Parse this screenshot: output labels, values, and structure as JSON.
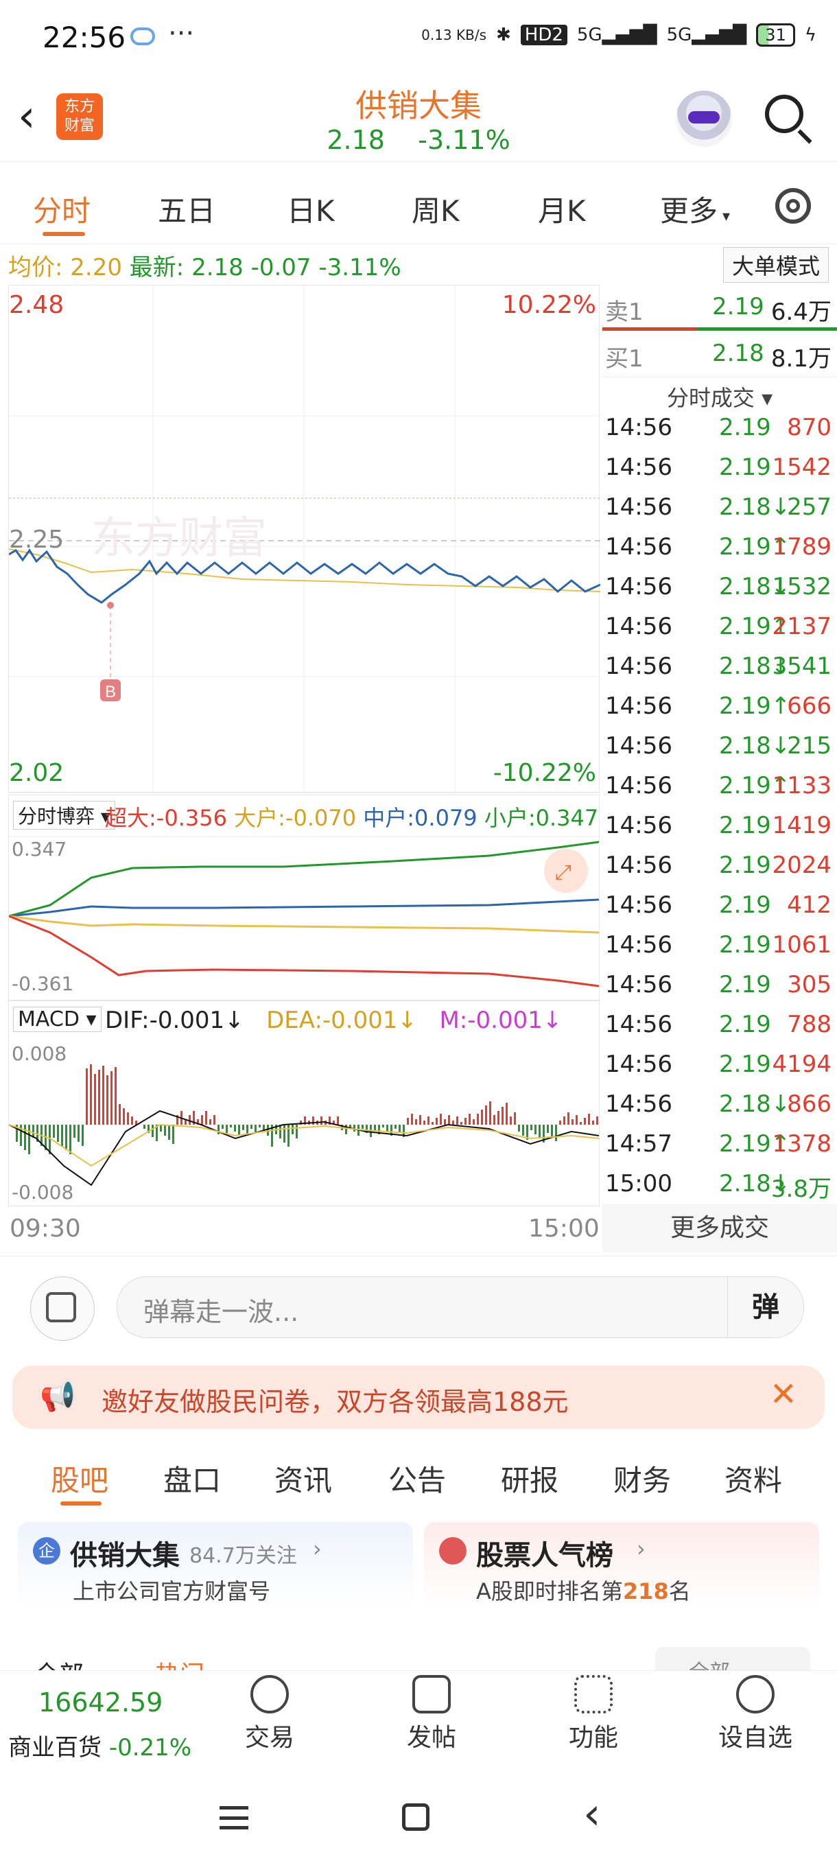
{
  "status": {
    "time": "22:56",
    "dots": "···",
    "netspeed": "0.13 KB/s",
    "hd": "HD2",
    "signal1": "5G",
    "signal2": "5G",
    "battery": "31"
  },
  "header": {
    "title": "供销大集",
    "price": "2.18",
    "change": "-3.11%",
    "logo_line1": "东方",
    "logo_line2": "财富"
  },
  "tabs": [
    "分时",
    "五日",
    "日K",
    "周K",
    "月K",
    "更多"
  ],
  "info": {
    "avg_label": "均价:",
    "avg": "2.20",
    "latest_label": "最新:",
    "latest": "2.18",
    "chg": "-0.07",
    "pct": "-3.11%",
    "mode_btn": "大单模式"
  },
  "chart": {
    "top_price": "2.48",
    "top_pct": "10.22%",
    "bottom_price": "2.02",
    "bottom_pct": "-10.22%",
    "ref_price": "2.25",
    "watermark": "东方财富",
    "marker": "B",
    "time_start": "09:30",
    "time_end": "15:00",
    "fund": {
      "selector": "分时博弈",
      "super_label": "超大:",
      "super": "-0.356",
      "big_label": "大户:",
      "big": "-0.070",
      "mid_label": "中户:",
      "mid": "0.079",
      "small_label": "小户:",
      "small": "0.347",
      "max": "0.347",
      "min": "-0.361"
    },
    "macd": {
      "selector": "MACD",
      "dif": "DIF:-0.001",
      "dea": "DEA:-0.001",
      "m": "M:-0.001",
      "max": "0.008",
      "min": "-0.008"
    },
    "colors": {
      "price": "#2c64ad",
      "avg": "#e8c04a",
      "up": "#e23c2f",
      "down": "#22972a"
    }
  },
  "orderbook": {
    "sell1": {
      "label": "卖1",
      "price": "2.19",
      "vol": "6.4万"
    },
    "buy1": {
      "label": "买1",
      "price": "2.18",
      "vol": "8.1万"
    },
    "trades_title": "分时成交",
    "trades": [
      {
        "t": "14:56",
        "p": "2.19",
        "d": "",
        "v": "870",
        "c": "red"
      },
      {
        "t": "14:56",
        "p": "2.19",
        "d": "",
        "v": "1542",
        "c": "red"
      },
      {
        "t": "14:56",
        "p": "2.18",
        "d": "↓",
        "v": "257",
        "c": "green"
      },
      {
        "t": "14:56",
        "p": "2.19",
        "d": "↑",
        "v": "1789",
        "c": "red"
      },
      {
        "t": "14:56",
        "p": "2.18",
        "d": "↓",
        "v": "1532",
        "c": "green"
      },
      {
        "t": "14:56",
        "p": "2.19",
        "d": "↑",
        "v": "2137",
        "c": "red"
      },
      {
        "t": "14:56",
        "p": "2.18",
        "d": "↓",
        "v": "3541",
        "c": "green"
      },
      {
        "t": "14:56",
        "p": "2.19",
        "d": "↑",
        "v": "666",
        "c": "red"
      },
      {
        "t": "14:56",
        "p": "2.18",
        "d": "↓",
        "v": "215",
        "c": "green"
      },
      {
        "t": "14:56",
        "p": "2.19",
        "d": "↑",
        "v": "1133",
        "c": "red"
      },
      {
        "t": "14:56",
        "p": "2.19",
        "d": "",
        "v": "1419",
        "c": "red"
      },
      {
        "t": "14:56",
        "p": "2.19",
        "d": "",
        "v": "2024",
        "c": "red"
      },
      {
        "t": "14:56",
        "p": "2.19",
        "d": "",
        "v": "412",
        "c": "red"
      },
      {
        "t": "14:56",
        "p": "2.19",
        "d": "",
        "v": "1061",
        "c": "red"
      },
      {
        "t": "14:56",
        "p": "2.19",
        "d": "",
        "v": "305",
        "c": "red"
      },
      {
        "t": "14:56",
        "p": "2.19",
        "d": "",
        "v": "788",
        "c": "red"
      },
      {
        "t": "14:56",
        "p": "2.19",
        "d": "",
        "v": "4194",
        "c": "red"
      },
      {
        "t": "14:56",
        "p": "2.18",
        "d": "↓",
        "v": "866",
        "c": "red"
      },
      {
        "t": "14:57",
        "p": "2.19",
        "d": "↑",
        "v": "1378",
        "c": "red"
      },
      {
        "t": "15:00",
        "p": "2.18",
        "d": "↓",
        "v": "3.8万",
        "c": "green"
      }
    ],
    "more": "更多成交"
  },
  "danmu": {
    "placeholder": "弹幕走一波...",
    "btn": "弹"
  },
  "banner": {
    "text": "邀好友做股民问卷，双方各领最高188元"
  },
  "section_tabs": [
    "股吧",
    "盘口",
    "资讯",
    "公告",
    "研报",
    "财务",
    "资料"
  ],
  "cards": {
    "c1_title": "供销大集",
    "c1_follow": "84.7万关注",
    "c1_sub": "上市公司官方财富号",
    "c2_title": "股票人气榜",
    "c2_sub_pre": "A股即时排名第",
    "c2_rank": "218",
    "c2_sub_post": "名"
  },
  "partial": {
    "left": "全部",
    "mid": "热门",
    "right": "全部"
  },
  "bottom_nav": {
    "index": "16642.59",
    "index_name": "商业百货",
    "index_pct": "-0.21%",
    "items": [
      "交易",
      "发帖",
      "功能",
      "设自选"
    ]
  }
}
